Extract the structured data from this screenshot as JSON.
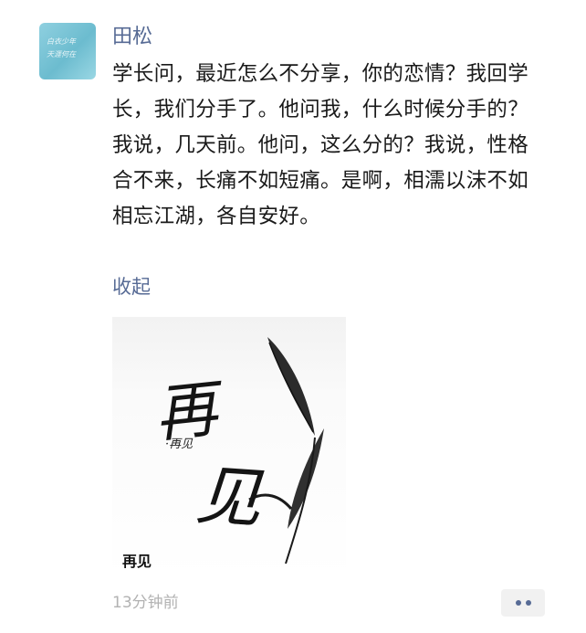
{
  "post": {
    "author": "田松",
    "avatar_lines": "白衣少年\n天涯何在",
    "text": "学长问，最近怎么不分享，你的恋情？我回学长，我们分手了。他问我，什么时候分手的？我说，几天前。他问，这么分的？我说，性格合不来，长痛不如短痛。是啊，相濡以沫不如相忘江湖，各自安好。",
    "collapse_label": "收起",
    "image": {
      "char_top": "再",
      "char_bottom": "见",
      "signature": "·再见",
      "caption": "再见"
    },
    "timestamp": "13分钟前",
    "more_icon": "ellipsis-icon"
  },
  "colors": {
    "link": "#576b95",
    "text": "#1a1a1a",
    "muted": "#b2b2b2"
  }
}
